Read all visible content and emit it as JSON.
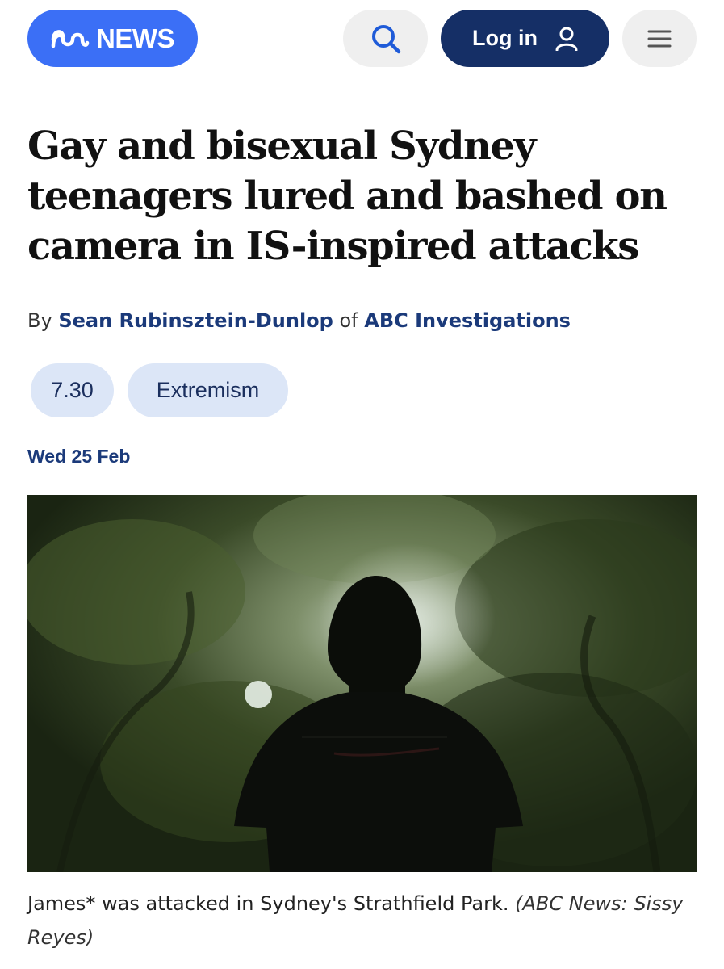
{
  "header": {
    "logo_text": "NEWS",
    "login_label": "Log in",
    "icons": {
      "logo": "abc-wave-logo-icon",
      "search": "search-icon",
      "user": "user-icon",
      "menu": "hamburger-menu-icon"
    }
  },
  "article": {
    "headline": "Gay and bisexual Sydney teenagers lured and bashed on camera in IS-inspired attacks",
    "byline": {
      "prefix": "By",
      "author": "Sean Rubinsztein-Dunlop",
      "of": "of",
      "org": "ABC Investigations"
    },
    "tags": [
      "7.30",
      "Extremism"
    ],
    "date": "Wed 25 Feb",
    "image_caption": "James* was attacked in Sydney's Strathfield Park.",
    "image_credit": "(ABC News: Sissy Reyes)"
  },
  "colors": {
    "brand_blue": "#3b6ff6",
    "navy": "#152f66",
    "link_blue": "#1b3a7a",
    "tag_bg": "#dce6f7",
    "button_grey": "#efefef"
  }
}
